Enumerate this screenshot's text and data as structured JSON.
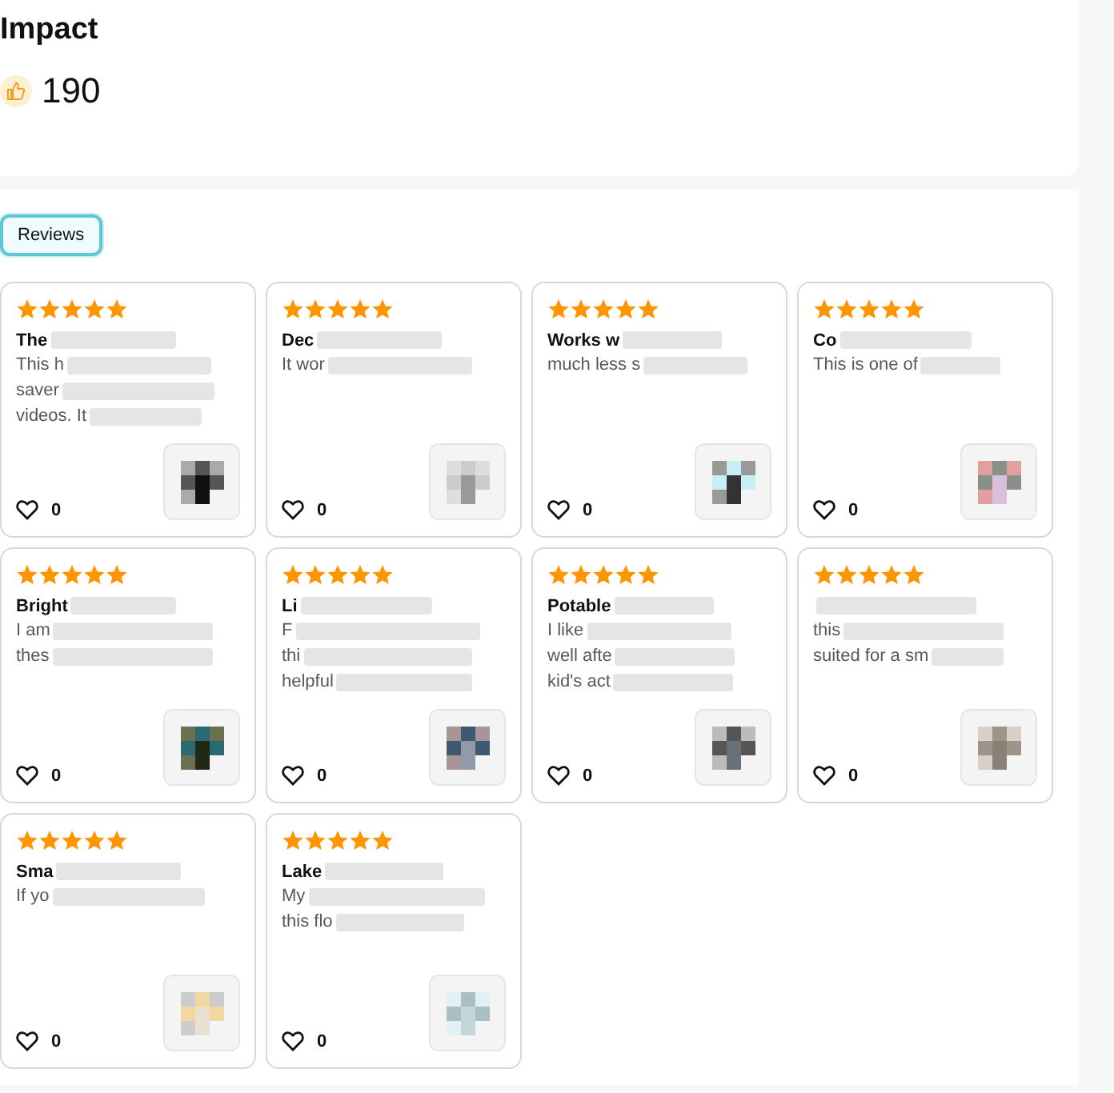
{
  "impact": {
    "title": "Impact",
    "count": "190"
  },
  "tabs": [
    {
      "label": "Reviews",
      "selected": true
    }
  ],
  "reviews": [
    {
      "stars": 5,
      "title": "The",
      "lines": [
        "This h",
        "saver",
        "videos. It"
      ],
      "likes": "0"
    },
    {
      "stars": 5,
      "title": "Dec",
      "lines": [
        "It wor"
      ],
      "likes": "0"
    },
    {
      "stars": 5,
      "title": "Works w",
      "lines": [
        "much less s"
      ],
      "likes": "0"
    },
    {
      "stars": 5,
      "title": "Co",
      "lines": [
        "This is one of"
      ],
      "likes": "0"
    },
    {
      "stars": 5,
      "title": "Bright",
      "lines": [
        "I am",
        "thes"
      ],
      "likes": "0"
    },
    {
      "stars": 5,
      "title": "Li",
      "lines": [
        "F",
        "thi",
        "helpful"
      ],
      "likes": "0"
    },
    {
      "stars": 5,
      "title": "Potable",
      "lines": [
        "I like",
        "well afte",
        "kid's act"
      ],
      "likes": "0"
    },
    {
      "stars": 5,
      "lines": [
        "this",
        "suited for a sm"
      ],
      "likes": "0"
    },
    {
      "stars": 5,
      "title": "Sma",
      "lines": [
        "If yo"
      ],
      "likes": "0"
    },
    {
      "stars": 5,
      "title": "Lake",
      "lines": [
        "My",
        "this flo"
      ],
      "likes": "0"
    }
  ]
}
